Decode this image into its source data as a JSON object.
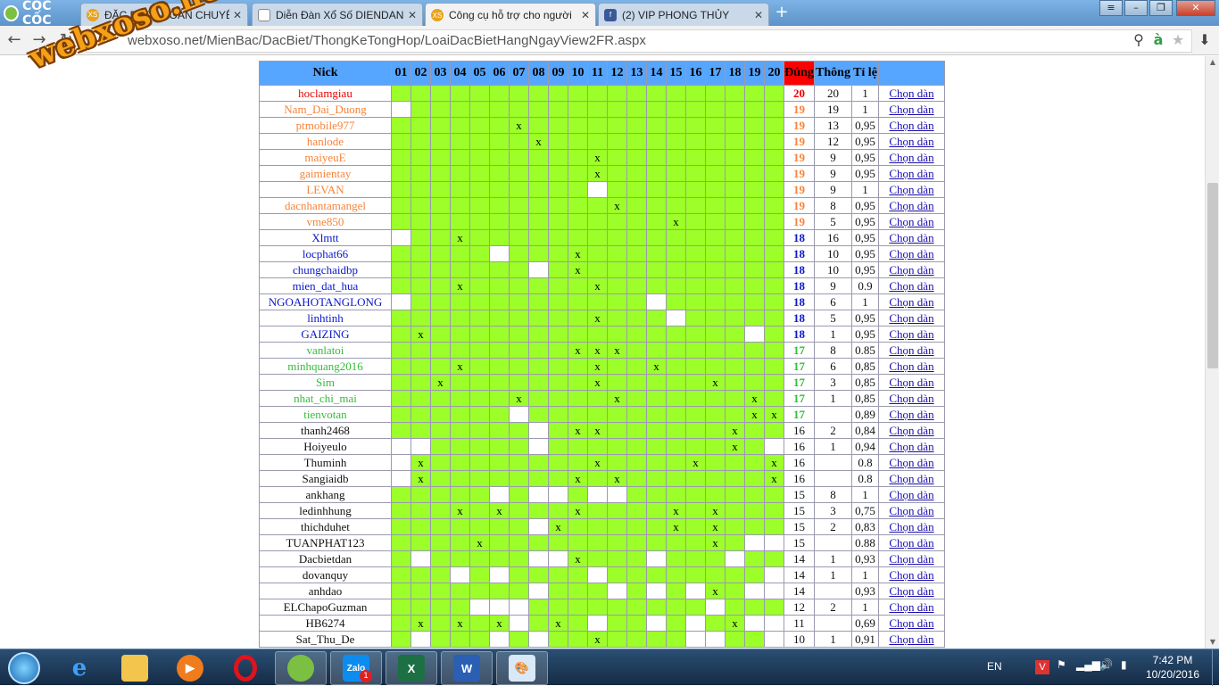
{
  "browser": {
    "brand": "CỐC CỐC",
    "url": "webxoso.net/MienBac/DacBiet/ThongKeTongHop/LoaiDacBietHangNgayView2FR.aspx",
    "watermark": "webxoso.net",
    "tabs": [
      {
        "title": "ĐẶC BIỆT - TOÀN CHUYÊN",
        "icon": "xs-icon",
        "active": false
      },
      {
        "title": "Diễn Đàn Xổ Số DIENDAN",
        "icon": "page-icon",
        "active": false
      },
      {
        "title": "Công cụ hỗ trợ cho người",
        "icon": "xs-icon",
        "active": true
      },
      {
        "title": "(2) VIP PHONG THỦY",
        "icon": "facebook-icon",
        "active": false
      }
    ]
  },
  "table": {
    "headers": {
      "nick": "Nick",
      "days": [
        "01",
        "02",
        "03",
        "04",
        "05",
        "06",
        "07",
        "08",
        "09",
        "10",
        "11",
        "12",
        "13",
        "14",
        "15",
        "16",
        "17",
        "18",
        "19",
        "20"
      ],
      "dung": "Đúng",
      "thong": "Thông",
      "tile": "Tỉ lệ",
      "action": ""
    },
    "rows": [
      {
        "nick": "hoclamgiau",
        "cells": "gggggggggggggggggggg",
        "dung": "20",
        "thong": "20",
        "tile": "1"
      },
      {
        "nick": "Nam_Dai_Duong",
        "cells": "wggggggggggggggggggg",
        "dung": "19",
        "thong": "19",
        "tile": "1"
      },
      {
        "nick": "ptmobile977",
        "cells": "ggggggxggggggggggggg",
        "dung": "19",
        "thong": "13",
        "tile": "0,95"
      },
      {
        "nick": "hanlode",
        "cells": "gggggggxgggggggggggg",
        "dung": "19",
        "thong": "12",
        "tile": "0,95"
      },
      {
        "nick": "maiyeuE",
        "cells": "ggggggggggxggggggggg",
        "dung": "19",
        "thong": "9",
        "tile": "0,95"
      },
      {
        "nick": "gaimientay",
        "cells": "ggggggggggxggggggggg",
        "dung": "19",
        "thong": "9",
        "tile": "0,95"
      },
      {
        "nick": "LEVAN",
        "cells": "ggggggggggwggggggggg",
        "dung": "19",
        "thong": "9",
        "tile": "1"
      },
      {
        "nick": "dacnhantamangel",
        "cells": "gggggggggggxgggggggg",
        "dung": "19",
        "thong": "8",
        "tile": "0,95"
      },
      {
        "nick": "vme850",
        "cells": "ggggggggggggggxggggg",
        "dung": "19",
        "thong": "5",
        "tile": "0,95"
      },
      {
        "nick": "Xlmtt",
        "cells": "wggxgggggggggggggggg",
        "dung": "18",
        "thong": "16",
        "tile": "0,95"
      },
      {
        "nick": "locphat66",
        "cells": "gggggwgggxgggggggggg",
        "dung": "18",
        "thong": "10",
        "tile": "0,95"
      },
      {
        "nick": "chungchaidbp",
        "cells": "gggggggwgxgggggggggg",
        "dung": "18",
        "thong": "10",
        "tile": "0,95"
      },
      {
        "nick": "mien_dat_hua",
        "cells": "gggxggggggxggggggggg",
        "dung": "18",
        "thong": "9",
        "tile": "0.9"
      },
      {
        "nick": "NGOAHOTANGLONG",
        "cells": "wggggggggggggwgggggg",
        "dung": "18",
        "thong": "6",
        "tile": "1"
      },
      {
        "nick": "linhtinh",
        "cells": "ggggggggggxgggwggggg",
        "dung": "18",
        "thong": "5",
        "tile": "0,95"
      },
      {
        "nick": "GAIZING",
        "cells": "gxggggggggggggggggwg",
        "dung": "18",
        "thong": "1",
        "tile": "0,95"
      },
      {
        "nick": "vanlatoi",
        "cells": "gggggggggxxxgggggggg",
        "dung": "17",
        "thong": "8",
        "tile": "0.85"
      },
      {
        "nick": "minhquang2016",
        "cells": "gggxggggggxggxgggggg",
        "dung": "17",
        "thong": "6",
        "tile": "0,85"
      },
      {
        "nick": "Sim",
        "cells": "ggxgggggggxgggggxggg",
        "dung": "17",
        "thong": "3",
        "tile": "0,85"
      },
      {
        "nick": "nhat_chi_mai",
        "cells": "ggggggxggggxggggggxg",
        "dung": "17",
        "thong": "1",
        "tile": "0,85"
      },
      {
        "nick": "tienvotan",
        "cells": "ggggggwgggggggggggxx",
        "dung": "17",
        "thong": "",
        "tile": "0,89"
      },
      {
        "nick": "thanh2468",
        "cells": "gggggggwgxxggggggxgg",
        "dung": "16",
        "thong": "2",
        "tile": "0,84"
      },
      {
        "nick": "Hoiyeulo",
        "cells": "wwgggggwgggggggggxgw",
        "dung": "16",
        "thong": "1",
        "tile": "0,94"
      },
      {
        "nick": "Thuminh",
        "cells": "wxggggggggxggggxgggx",
        "dung": "16",
        "thong": "",
        "tile": "0.8"
      },
      {
        "nick": "Sangiaidb",
        "cells": "wxgggggggxgxgggggggx",
        "dung": "16",
        "thong": "",
        "tile": "0.8"
      },
      {
        "nick": "ankhang",
        "cells": "gggggwgwwgwwgggggggg",
        "dung": "15",
        "thong": "8",
        "tile": "1"
      },
      {
        "nick": "ledinhhung",
        "cells": "gggxgxgggxggggxgxggg",
        "dung": "15",
        "thong": "3",
        "tile": "0,75"
      },
      {
        "nick": "thichduhet",
        "cells": "gggggggwxgggggxgxggg",
        "dung": "15",
        "thong": "2",
        "tile": "0,83"
      },
      {
        "nick": "TUANPHAT123",
        "cells": "ggggxgggggggggggxgww",
        "dung": "15",
        "thong": "",
        "tile": "0.88"
      },
      {
        "nick": "Dacbietdan",
        "cells": "gwgggggwwxgggwgggwgg",
        "dung": "14",
        "thong": "1",
        "tile": "0,93"
      },
      {
        "nick": "dovanquy",
        "cells": "gggwgwggggwggggggggw",
        "dung": "14",
        "thong": "1",
        "tile": "1"
      },
      {
        "nick": "anhdao",
        "cells": "gggggggwgggwgwgwxgww",
        "dung": "14",
        "thong": "",
        "tile": "0,93"
      },
      {
        "nick": "ELChapoGuzman",
        "cells": "ggggwwwgggggggggwggg",
        "dung": "12",
        "thong": "2",
        "tile": "1"
      },
      {
        "nick": "HB6274",
        "cells": "gxgxgxwgxgwggwgwgxww",
        "dung": "11",
        "thong": "",
        "tile": "0,69"
      },
      {
        "nick": "Sat_Thu_De",
        "cells": "gwgggwgwggxggggwwggw",
        "dung": "10",
        "thong": "1",
        "tile": "0,91"
      }
    ],
    "action_label": "Chọn dàn",
    "mark": "x"
  },
  "taskbar": {
    "lang": "EN",
    "time": "7:42 PM",
    "date": "10/20/2016",
    "zalo_badge": "1",
    "zalo_label": "Zalo"
  },
  "colors": {
    "header": "#56a5ff",
    "dung_header": "#ff0000",
    "cell_green": "#9dff29",
    "level20": "#ee0000",
    "level19": "#f5843c",
    "level18": "#0b18c9",
    "level17": "#34bd3a"
  }
}
